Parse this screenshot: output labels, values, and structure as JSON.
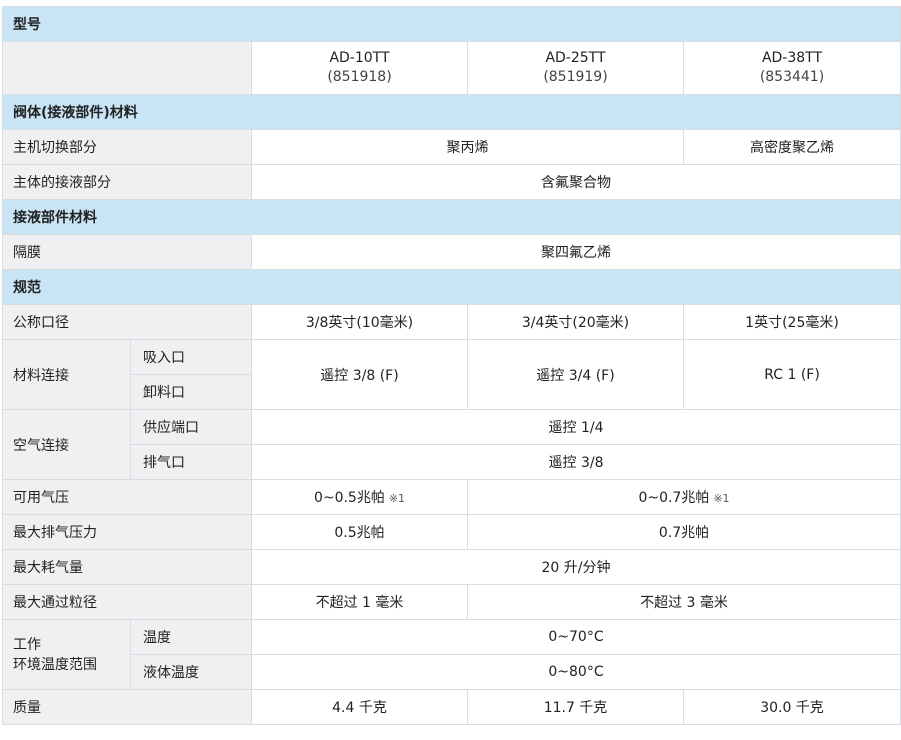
{
  "sections": {
    "model": "型号",
    "body_material": "阀体(接液部件)材料",
    "wetted_material": "接液部件材料",
    "specs": "规范"
  },
  "models": [
    {
      "name": "AD-10TT",
      "code": "(851918)"
    },
    {
      "name": "AD-25TT",
      "code": "(851919)"
    },
    {
      "name": "AD-38TT",
      "code": "(853441)"
    }
  ],
  "rows": {
    "main_switch": {
      "label": "主机切换部分",
      "val_a": "聚丙烯",
      "val_b": "高密度聚乙烯"
    },
    "body_wetted": {
      "label": "主体的接液部分",
      "val": "含氟聚合物"
    },
    "diaphragm": {
      "label": "隔膜",
      "val": "聚四氟乙烯"
    },
    "bore": {
      "label": "公称口径",
      "vals": [
        "3/8英寸(10毫米)",
        "3/4英寸(20毫米)",
        "1英寸(25毫米)"
      ]
    },
    "material_conn": {
      "label": "材料连接",
      "sub1": "吸入口",
      "sub2": "卸料口",
      "vals": [
        "遥控 3/8 (F)",
        "遥控 3/4 (F)",
        "RC 1 (F)"
      ]
    },
    "air_conn": {
      "label": "空气连接",
      "sub1": "供应端口",
      "val1": "遥控 1/4",
      "sub2": "排气口",
      "val2": "遥控 3/8"
    },
    "air_pressure": {
      "label": "可用气压",
      "val_a": "0~0.5兆帕",
      "val_b": "0~0.7兆帕",
      "note": "※1"
    },
    "max_discharge": {
      "label": "最大排气压力",
      "val_a": "0.5兆帕",
      "val_b": "0.7兆帕"
    },
    "max_air": {
      "label": "最大耗气量",
      "val": "20 升/分钟"
    },
    "max_particle": {
      "label": "最大通过粒径",
      "val_a": "不超过 1 毫米",
      "val_b": "不超过 3 毫米"
    },
    "temp": {
      "label_line1": "工作",
      "label_line2": "环境温度范围",
      "sub1": "温度",
      "val1": "0~70°C",
      "sub2": "液体温度",
      "val2": "0~80°C"
    },
    "mass": {
      "label": "质量",
      "vals": [
        "4.4 千克",
        "11.7 千克",
        "30.0 千克"
      ]
    }
  },
  "colors": {
    "section_bg": "#c9e4f5",
    "label_bg": "#eef0f2",
    "border": "#d9dde2"
  }
}
